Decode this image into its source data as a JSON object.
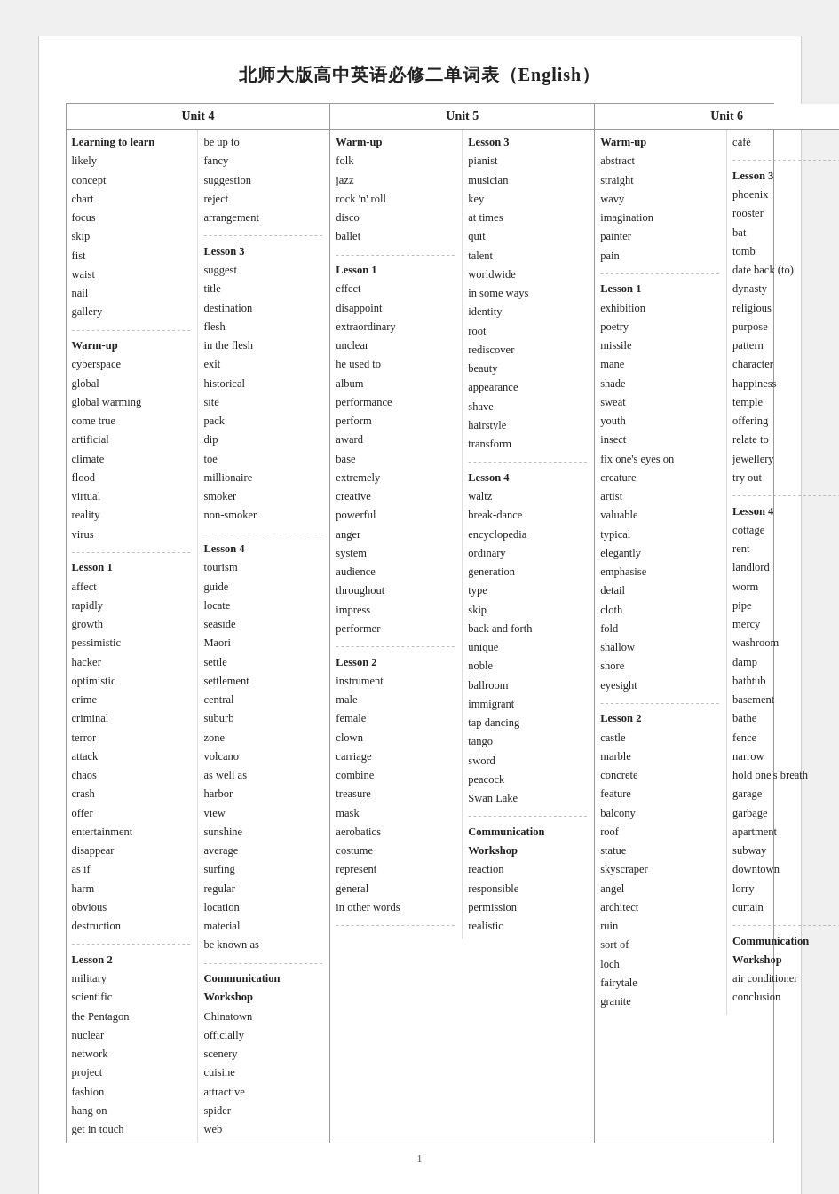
{
  "title": "北师大版高中英语必修二单词表（English）",
  "units": [
    {
      "name": "Unit 4",
      "cols": [
        {
          "items": [
            {
              "text": "Learning to learn",
              "type": "bold"
            },
            {
              "text": "likely"
            },
            {
              "text": "concept"
            },
            {
              "text": "chart"
            },
            {
              "text": "focus"
            },
            {
              "text": "skip"
            },
            {
              "text": "fist"
            },
            {
              "text": "waist"
            },
            {
              "text": "nail"
            },
            {
              "text": "gallery"
            },
            {
              "text": "------------------------",
              "type": "divider"
            },
            {
              "text": "Warm-up",
              "type": "bold"
            },
            {
              "text": "cyberspace"
            },
            {
              "text": "global"
            },
            {
              "text": "global warming"
            },
            {
              "text": "come true"
            },
            {
              "text": "artificial"
            },
            {
              "text": "climate"
            },
            {
              "text": "flood"
            },
            {
              "text": "virtual"
            },
            {
              "text": "reality"
            },
            {
              "text": "virus"
            },
            {
              "text": "------------------------",
              "type": "divider"
            },
            {
              "text": "Lesson 1",
              "type": "bold"
            },
            {
              "text": "affect"
            },
            {
              "text": "rapidly"
            },
            {
              "text": "growth"
            },
            {
              "text": "pessimistic"
            },
            {
              "text": "hacker"
            },
            {
              "text": "optimistic"
            },
            {
              "text": "crime"
            },
            {
              "text": "criminal"
            },
            {
              "text": "terror"
            },
            {
              "text": "attack"
            },
            {
              "text": "chaos"
            },
            {
              "text": "crash"
            },
            {
              "text": "offer"
            },
            {
              "text": "entertainment"
            },
            {
              "text": "disappear"
            },
            {
              "text": "as if"
            },
            {
              "text": "harm"
            },
            {
              "text": "obvious"
            },
            {
              "text": "destruction"
            },
            {
              "text": "------------------------",
              "type": "divider"
            },
            {
              "text": "Lesson 2",
              "type": "bold"
            },
            {
              "text": "military"
            },
            {
              "text": "scientific"
            },
            {
              "text": "the Pentagon"
            },
            {
              "text": "nuclear"
            },
            {
              "text": "network"
            },
            {
              "text": "project"
            },
            {
              "text": "fashion"
            },
            {
              "text": "hang on"
            },
            {
              "text": "get in touch"
            }
          ]
        },
        {
          "items": [
            {
              "text": "be up to"
            },
            {
              "text": "fancy"
            },
            {
              "text": "suggestion"
            },
            {
              "text": "reject"
            },
            {
              "text": "arrangement"
            },
            {
              "text": "------------------------",
              "type": "divider"
            },
            {
              "text": "Lesson 3",
              "type": "bold"
            },
            {
              "text": "suggest"
            },
            {
              "text": "title"
            },
            {
              "text": "destination"
            },
            {
              "text": "flesh"
            },
            {
              "text": "in the flesh"
            },
            {
              "text": "exit"
            },
            {
              "text": "historical"
            },
            {
              "text": "site"
            },
            {
              "text": "pack"
            },
            {
              "text": "dip"
            },
            {
              "text": "toe"
            },
            {
              "text": "millionaire"
            },
            {
              "text": "smoker"
            },
            {
              "text": "non-smoker"
            },
            {
              "text": "------------------------",
              "type": "divider"
            },
            {
              "text": "Lesson 4",
              "type": "bold"
            },
            {
              "text": "tourism"
            },
            {
              "text": "guide"
            },
            {
              "text": "locate"
            },
            {
              "text": "seaside"
            },
            {
              "text": "Maori"
            },
            {
              "text": "settle"
            },
            {
              "text": "settlement"
            },
            {
              "text": "central"
            },
            {
              "text": "suburb"
            },
            {
              "text": "zone"
            },
            {
              "text": "volcano"
            },
            {
              "text": "as well as"
            },
            {
              "text": "harbor"
            },
            {
              "text": "view"
            },
            {
              "text": "sunshine"
            },
            {
              "text": "average"
            },
            {
              "text": "surfing"
            },
            {
              "text": "regular"
            },
            {
              "text": "location"
            },
            {
              "text": "material"
            },
            {
              "text": "be known as"
            },
            {
              "text": "------------------------",
              "type": "divider"
            },
            {
              "text": "Communication",
              "type": "bold"
            },
            {
              "text": "Workshop",
              "type": "bold"
            },
            {
              "text": "Chinatown"
            },
            {
              "text": "officially"
            },
            {
              "text": "scenery"
            },
            {
              "text": "cuisine"
            },
            {
              "text": "attractive"
            },
            {
              "text": "spider"
            },
            {
              "text": "web"
            }
          ]
        }
      ]
    },
    {
      "name": "Unit 5",
      "cols": [
        {
          "items": [
            {
              "text": "Warm-up",
              "type": "bold"
            },
            {
              "text": "folk"
            },
            {
              "text": "jazz"
            },
            {
              "text": "rock 'n' roll"
            },
            {
              "text": "disco"
            },
            {
              "text": "ballet"
            },
            {
              "text": "------------------------",
              "type": "divider"
            },
            {
              "text": "Lesson 1",
              "type": "bold"
            },
            {
              "text": "effect"
            },
            {
              "text": "disappoint"
            },
            {
              "text": "extraordinary"
            },
            {
              "text": "unclear"
            },
            {
              "text": "he used to"
            },
            {
              "text": "album"
            },
            {
              "text": "performance"
            },
            {
              "text": "perform"
            },
            {
              "text": "award"
            },
            {
              "text": "base"
            },
            {
              "text": "extremely"
            },
            {
              "text": "creative"
            },
            {
              "text": "powerful"
            },
            {
              "text": "anger"
            },
            {
              "text": "system"
            },
            {
              "text": "audience"
            },
            {
              "text": "throughout"
            },
            {
              "text": "impress"
            },
            {
              "text": "performer"
            },
            {
              "text": "------------------------",
              "type": "divider"
            },
            {
              "text": "Lesson 2",
              "type": "bold"
            },
            {
              "text": "instrument"
            },
            {
              "text": "male"
            },
            {
              "text": "female"
            },
            {
              "text": "clown"
            },
            {
              "text": "carriage"
            },
            {
              "text": "combine"
            },
            {
              "text": "treasure"
            },
            {
              "text": "mask"
            },
            {
              "text": "aerobatics"
            },
            {
              "text": "costume"
            },
            {
              "text": "represent"
            },
            {
              "text": "general"
            },
            {
              "text": "in other words"
            },
            {
              "text": "------------------------",
              "type": "divider"
            }
          ]
        },
        {
          "items": [
            {
              "text": "Lesson 3",
              "type": "bold"
            },
            {
              "text": "pianist"
            },
            {
              "text": "musician"
            },
            {
              "text": "key"
            },
            {
              "text": "at times"
            },
            {
              "text": "quit"
            },
            {
              "text": "talent"
            },
            {
              "text": "worldwide"
            },
            {
              "text": "in some ways"
            },
            {
              "text": "identity"
            },
            {
              "text": "root"
            },
            {
              "text": "rediscover"
            },
            {
              "text": "beauty"
            },
            {
              "text": "appearance"
            },
            {
              "text": "shave"
            },
            {
              "text": "hairstyle"
            },
            {
              "text": "transform"
            },
            {
              "text": "------------------------",
              "type": "divider"
            },
            {
              "text": "Lesson 4",
              "type": "bold"
            },
            {
              "text": "waltz"
            },
            {
              "text": "break-dance"
            },
            {
              "text": "encyclopedia"
            },
            {
              "text": "ordinary"
            },
            {
              "text": "generation"
            },
            {
              "text": "type"
            },
            {
              "text": "skip"
            },
            {
              "text": "back and forth"
            },
            {
              "text": "unique"
            },
            {
              "text": "noble"
            },
            {
              "text": "ballroom"
            },
            {
              "text": "immigrant"
            },
            {
              "text": "tap dancing"
            },
            {
              "text": "tango"
            },
            {
              "text": "sword"
            },
            {
              "text": "peacock"
            },
            {
              "text": "Swan Lake"
            },
            {
              "text": "------------------------",
              "type": "divider"
            },
            {
              "text": "Communication",
              "type": "bold"
            },
            {
              "text": "Workshop",
              "type": "bold"
            },
            {
              "text": "reaction"
            },
            {
              "text": "responsible"
            },
            {
              "text": "permission"
            },
            {
              "text": "realistic"
            }
          ]
        }
      ]
    },
    {
      "name": "Unit 6",
      "cols": [
        {
          "items": [
            {
              "text": "Warm-up",
              "type": "bold"
            },
            {
              "text": "abstract"
            },
            {
              "text": "straight"
            },
            {
              "text": "wavy"
            },
            {
              "text": "imagination"
            },
            {
              "text": "painter"
            },
            {
              "text": "pain"
            },
            {
              "text": "------------------------",
              "type": "divider"
            },
            {
              "text": "Lesson 1",
              "type": "bold"
            },
            {
              "text": "exhibition"
            },
            {
              "text": "poetry"
            },
            {
              "text": "missile"
            },
            {
              "text": "mane"
            },
            {
              "text": "shade"
            },
            {
              "text": "sweat"
            },
            {
              "text": "youth"
            },
            {
              "text": "insect"
            },
            {
              "text": "fix one's eyes on"
            },
            {
              "text": "creature"
            },
            {
              "text": "artist"
            },
            {
              "text": "valuable"
            },
            {
              "text": "typical"
            },
            {
              "text": "elegantly"
            },
            {
              "text": "emphasise"
            },
            {
              "text": "detail"
            },
            {
              "text": "cloth"
            },
            {
              "text": "fold"
            },
            {
              "text": "shallow"
            },
            {
              "text": "shore"
            },
            {
              "text": "eyesight"
            },
            {
              "text": "------------------------",
              "type": "divider"
            },
            {
              "text": "Lesson 2",
              "type": "bold"
            },
            {
              "text": "castle"
            },
            {
              "text": "marble"
            },
            {
              "text": "concrete"
            },
            {
              "text": "feature"
            },
            {
              "text": "balcony"
            },
            {
              "text": "roof"
            },
            {
              "text": "statue"
            },
            {
              "text": "skyscraper"
            },
            {
              "text": "angel"
            },
            {
              "text": "architect"
            },
            {
              "text": "ruin"
            },
            {
              "text": "sort of"
            },
            {
              "text": "loch"
            },
            {
              "text": "fairytale"
            },
            {
              "text": "granite"
            }
          ]
        },
        {
          "items": [
            {
              "text": "café"
            },
            {
              "text": "------------------------",
              "type": "divider"
            },
            {
              "text": "Lesson 3",
              "type": "bold"
            },
            {
              "text": "phoenix"
            },
            {
              "text": "rooster"
            },
            {
              "text": "bat"
            },
            {
              "text": "tomb"
            },
            {
              "text": "date back (to)"
            },
            {
              "text": "dynasty"
            },
            {
              "text": "religious"
            },
            {
              "text": "purpose"
            },
            {
              "text": "pattern"
            },
            {
              "text": "character"
            },
            {
              "text": "happiness"
            },
            {
              "text": "temple"
            },
            {
              "text": "offering"
            },
            {
              "text": "relate to"
            },
            {
              "text": "jewellery"
            },
            {
              "text": "try out"
            },
            {
              "text": "------------------------",
              "type": "divider"
            },
            {
              "text": "Lesson 4",
              "type": "bold"
            },
            {
              "text": "cottage"
            },
            {
              "text": "rent"
            },
            {
              "text": "landlord"
            },
            {
              "text": "worm"
            },
            {
              "text": "pipe"
            },
            {
              "text": "mercy"
            },
            {
              "text": "washroom"
            },
            {
              "text": "damp"
            },
            {
              "text": "bathtub"
            },
            {
              "text": "basement"
            },
            {
              "text": "bathe"
            },
            {
              "text": "fence"
            },
            {
              "text": "narrow"
            },
            {
              "text": "hold one's breath"
            },
            {
              "text": "garage"
            },
            {
              "text": "garbage"
            },
            {
              "text": "apartment"
            },
            {
              "text": "subway"
            },
            {
              "text": "downtown"
            },
            {
              "text": "lorry"
            },
            {
              "text": "curtain"
            },
            {
              "text": "------------------------",
              "type": "divider"
            },
            {
              "text": "Communication",
              "type": "bold"
            },
            {
              "text": "Workshop",
              "type": "bold"
            },
            {
              "text": "air conditioner"
            },
            {
              "text": "conclusion"
            }
          ]
        }
      ]
    }
  ],
  "page_number": "1"
}
